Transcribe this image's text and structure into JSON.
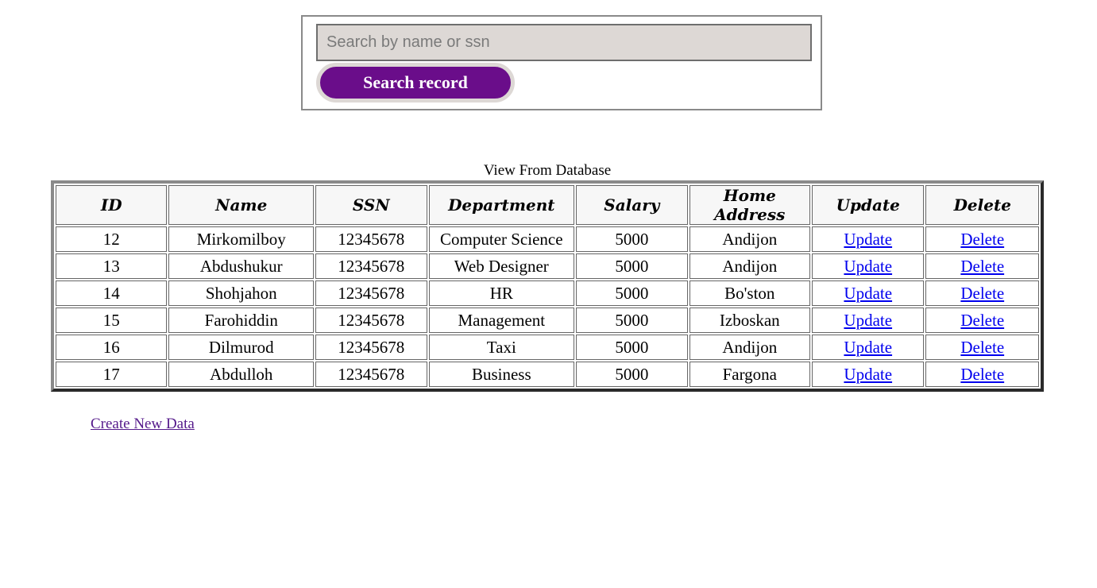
{
  "search": {
    "placeholder": "Search by name or ssn",
    "button_label": "Search record"
  },
  "table": {
    "caption": "View From Database",
    "headers": [
      "ID",
      "Name",
      "SSN",
      "Department",
      "Salary",
      "Home Address",
      "Update",
      "Delete"
    ],
    "rows": [
      {
        "id": "12",
        "name": "Mirkomilboy",
        "ssn": "12345678",
        "department": "Computer Science",
        "salary": "5000",
        "address": "Andijon",
        "update": "Update",
        "delete": "Delete"
      },
      {
        "id": "13",
        "name": "Abdushukur",
        "ssn": "12345678",
        "department": "Web Designer",
        "salary": "5000",
        "address": "Andijon",
        "update": "Update",
        "delete": "Delete"
      },
      {
        "id": "14",
        "name": "Shohjahon",
        "ssn": "12345678",
        "department": "HR",
        "salary": "5000",
        "address": "Bo'ston",
        "update": "Update",
        "delete": "Delete"
      },
      {
        "id": "15",
        "name": "Farohiddin",
        "ssn": "12345678",
        "department": "Management",
        "salary": "5000",
        "address": "Izboskan",
        "update": "Update",
        "delete": "Delete"
      },
      {
        "id": "16",
        "name": "Dilmurod",
        "ssn": "12345678",
        "department": "Taxi",
        "salary": "5000",
        "address": "Andijon",
        "update": "Update",
        "delete": "Delete"
      },
      {
        "id": "17",
        "name": "Abdulloh",
        "ssn": "12345678",
        "department": "Business",
        "salary": "5000",
        "address": "Fargona",
        "update": "Update",
        "delete": "Delete"
      }
    ]
  },
  "create_link": "Create New Data",
  "colors": {
    "button_bg": "#6a0d8a",
    "input_bg": "#ddd8d5",
    "link": "#0000ee",
    "visited_link": "#551a8b"
  }
}
